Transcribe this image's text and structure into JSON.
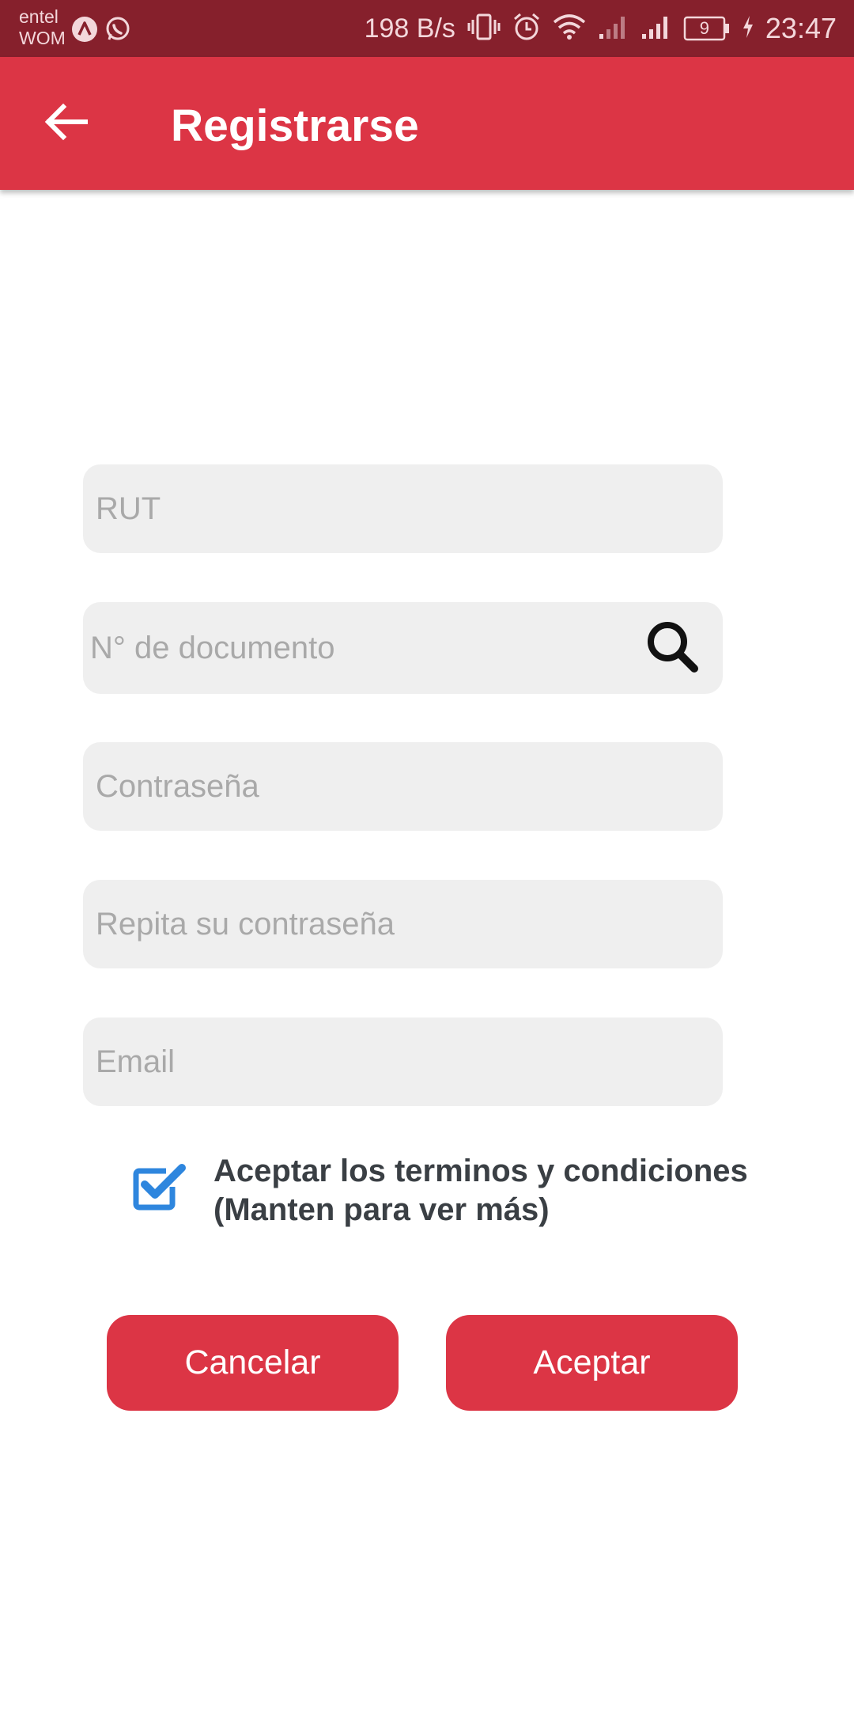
{
  "status_bar": {
    "carrier_1": "entel",
    "carrier_2": "WOM",
    "net_speed": "198 B/s",
    "battery_level": "9",
    "time": "23:47",
    "icons": [
      "arrow-notification-icon",
      "whatsapp-icon",
      "vibrate-icon",
      "alarm-icon",
      "wifi-icon",
      "signal-icon",
      "signal-icon",
      "battery-icon",
      "charging-icon"
    ]
  },
  "app_bar": {
    "title": "Registrarse",
    "back_icon": "arrow-left-icon",
    "color": "#dc3545"
  },
  "form": {
    "rut_placeholder": "RUT",
    "document_placeholder": "N° de documento",
    "search_icon": "search-icon",
    "password_placeholder": "Contraseña",
    "repeat_password_placeholder": "Repita su contraseña",
    "email_placeholder": "Email"
  },
  "terms": {
    "line_1": "Aceptar los terminos y condiciones",
    "line_2": "(Manten para ver más)",
    "checked": true,
    "checkbox_color": "#2e86de"
  },
  "buttons": {
    "cancel_label": "Cancelar",
    "accept_label": "Aceptar"
  }
}
